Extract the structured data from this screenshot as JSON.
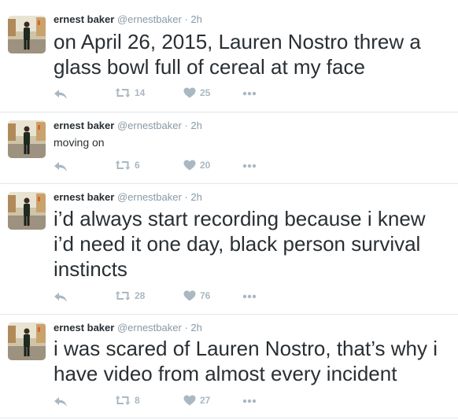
{
  "tweets": [
    {
      "name": "ernest baker",
      "handle": "@ernestbaker",
      "separator": "·",
      "time": "2h",
      "text": "on April 26, 2015, Lauren Nostro threw a glass bowl full of cereal at my face",
      "retweets": "14",
      "likes": "25"
    },
    {
      "name": "ernest baker",
      "handle": "@ernestbaker",
      "separator": "·",
      "time": "2h",
      "text": "moving on",
      "retweets": "6",
      "likes": "20"
    },
    {
      "name": "ernest baker",
      "handle": "@ernestbaker",
      "separator": "·",
      "time": "2h",
      "text": "i’d always start recording because i knew i’d need it one day, black person survival instincts",
      "retweets": "28",
      "likes": "76"
    },
    {
      "name": "ernest baker",
      "handle": "@ernestbaker",
      "separator": "·",
      "time": "2h",
      "text": "i was scared of Lauren Nostro, that’s why i have video from almost every incident",
      "retweets": "8",
      "likes": "27"
    }
  ],
  "icons": {
    "reply": "reply-icon",
    "retweet": "retweet-icon",
    "like": "heart-icon",
    "more": "more-icon"
  },
  "colors": {
    "text": "#292f33",
    "muted": "#8899a6",
    "action": "#aab8c2",
    "divider": "#e1e8ed"
  }
}
